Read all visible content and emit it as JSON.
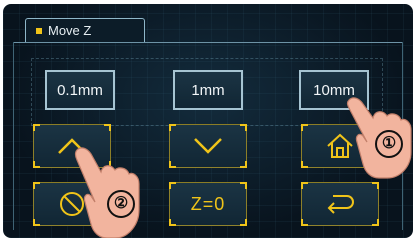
{
  "title": "Move Z",
  "step_buttons": [
    {
      "label": "0.1mm"
    },
    {
      "label": "1mm"
    },
    {
      "label": "10mm"
    }
  ],
  "action_buttons": {
    "z_zero_label": "Z=0"
  },
  "annotations": [
    {
      "label": "①"
    },
    {
      "label": "②"
    }
  ],
  "colors": {
    "background": "#08131d",
    "accent": "#f0c419",
    "button_border": "#a6c4d2",
    "text": "#f2f6f8"
  },
  "icons": [
    "chevron-up-icon",
    "chevron-down-icon",
    "home-icon",
    "cancel-icon",
    "back-arrow-icon"
  ]
}
